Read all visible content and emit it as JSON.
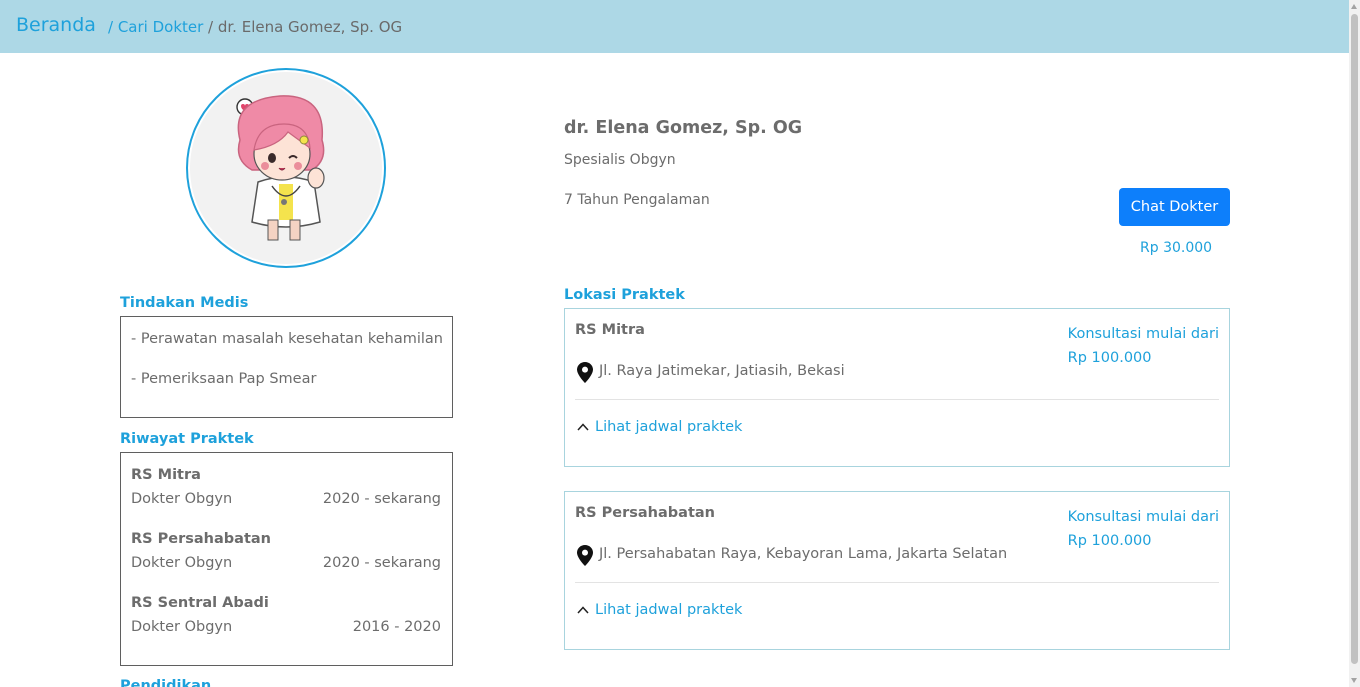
{
  "header": {
    "brand": "Beranda",
    "breadcrumb": [
      {
        "label": "/ Cari Dokter",
        "link": true
      },
      {
        "label": " / dr. Elena Gomez, Sp. OG",
        "link": false
      }
    ]
  },
  "doctor": {
    "name": "dr. Elena Gomez, Sp. OG",
    "specialty": "Spesialis Obgyn",
    "experience": "7 Tahun Pengalaman",
    "chat_button": "Chat Dokter",
    "chat_price": "Rp 30.000"
  },
  "tindakan": {
    "title": "Tindakan Medis",
    "items": [
      "- Perawatan masalah kesehatan kehamilan",
      "- Pemeriksaan Pap Smear"
    ]
  },
  "riwayat": {
    "title": "Riwayat Praktek",
    "entries": [
      {
        "hospital": "RS Mitra",
        "role": "Dokter Obgyn",
        "years": "2020 - sekarang"
      },
      {
        "hospital": "RS Persahabatan",
        "role": "Dokter Obgyn",
        "years": "2020 - sekarang"
      },
      {
        "hospital": "RS Sentral Abadi",
        "role": "Dokter Obgyn",
        "years": "2016 - 2020"
      }
    ]
  },
  "pendidikan": {
    "title": "Pendidikan"
  },
  "lokasi": {
    "title": "Lokasi Praktek",
    "cards": [
      {
        "name": "RS Mitra",
        "consult_label": "Konsultasi mulai dari",
        "consult_price": "Rp 100.000",
        "address": "Jl. Raya Jatimekar, Jatiasih, Bekasi",
        "schedule_link": "Lihat jadwal praktek"
      },
      {
        "name": "RS Persahabatan",
        "consult_label": "Konsultasi mulai dari",
        "consult_price": "Rp 100.000",
        "address": "Jl. Persahabatan Raya, Kebayoran Lama, Jakarta Selatan",
        "schedule_link": "Lihat jadwal praktek"
      }
    ]
  },
  "colors": {
    "accent": "#1ea1db",
    "header_bg": "#add8e6",
    "button": "#0d7ffb",
    "text": "#6c6c6c"
  },
  "icons": [
    "map-pin-icon",
    "chevron-up-icon",
    "doctor-avatar"
  ]
}
